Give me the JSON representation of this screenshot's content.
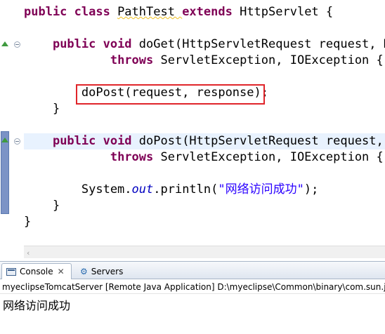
{
  "editor": {
    "lines": [
      {
        "segments": [
          {
            "t": "public class ",
            "c": "kw"
          },
          {
            "t": "PathTest "
          },
          {
            "t": "extends ",
            "c": "kw"
          },
          {
            "t": "HttpServlet {"
          }
        ]
      },
      {
        "segments": [
          {
            "t": "    "
          },
          {
            "t": "public void ",
            "c": "kw"
          },
          {
            "t": "doGet(HttpServletRequest request, Ht"
          }
        ]
      },
      {
        "segments": [
          {
            "t": "            "
          },
          {
            "t": "throws ",
            "c": "kw"
          },
          {
            "t": "ServletException, IOException {"
          }
        ]
      },
      {
        "segments": [
          {
            "t": "        doPost(request, response);"
          }
        ]
      },
      {
        "segments": [
          {
            "t": "    }"
          }
        ]
      },
      {
        "segments": [
          {
            "t": "    "
          },
          {
            "t": "public void ",
            "c": "kw"
          },
          {
            "t": "doPost(HttpServletRequest request, H"
          }
        ]
      },
      {
        "segments": [
          {
            "t": "            "
          },
          {
            "t": "throws ",
            "c": "kw"
          },
          {
            "t": "ServletException, IOException {"
          }
        ]
      },
      {
        "segments": [
          {
            "t": "        System."
          },
          {
            "t": "out",
            "c": "field"
          },
          {
            "t": ".println("
          },
          {
            "t": "\"网络访问成功\"",
            "c": "str"
          },
          {
            "t": ");"
          }
        ]
      },
      {
        "segments": [
          {
            "t": "    }"
          }
        ]
      },
      {
        "segments": [
          {
            "t": "}"
          }
        ]
      }
    ],
    "highlighted_statement": "doPost(request, response);"
  },
  "console_panel": {
    "tabs": [
      {
        "label": "Console",
        "close": "✕",
        "active": true
      },
      {
        "label": "Servers",
        "active": false
      }
    ],
    "launch_header": "myeclipseTomcatServer [Remote Java Application] D:\\myeclipse\\Common\\binary\\com.sun.java",
    "output": "网络访问成功"
  },
  "icons": {
    "console": "console-icon",
    "servers": "servers-icon",
    "close": "close-icon",
    "override_marker": "green-triangle-icon",
    "fold": "collapse-icon"
  },
  "colors": {
    "keyword": "#7f0055",
    "string": "#2a00ff",
    "static_field": "#0000c0",
    "highlight_box": "#e0252a"
  }
}
